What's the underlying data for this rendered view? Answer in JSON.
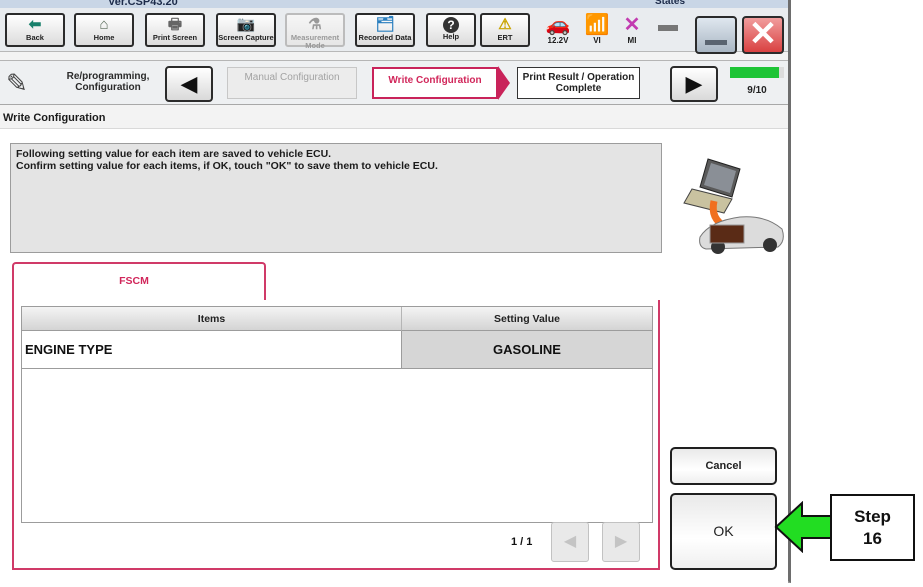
{
  "window": {
    "version": "Ver.CSP43.20",
    "states_label": "States"
  },
  "toolbar": {
    "buttons": [
      {
        "label": "Back",
        "icon": "back-arrow-icon",
        "glyph": "⬅",
        "enabled": true
      },
      {
        "label": "Home",
        "icon": "home-icon",
        "glyph": "⌂",
        "enabled": true
      },
      {
        "label": "Print Screen",
        "icon": "printer-icon",
        "glyph": "🖶",
        "enabled": true
      },
      {
        "label": "Screen Capture",
        "icon": "camera-icon",
        "glyph": "📷",
        "enabled": true
      },
      {
        "label": "Measurement Mode",
        "icon": "measurement-icon",
        "glyph": "⚗",
        "enabled": false
      },
      {
        "label": "Recorded Data",
        "icon": "recorded-data-icon",
        "glyph": "🗂",
        "enabled": true
      },
      {
        "label": "Help",
        "icon": "help-icon",
        "glyph": "?",
        "enabled": true
      },
      {
        "label": "ERT",
        "icon": "warning-icon",
        "glyph": "⚠",
        "enabled": true
      }
    ],
    "status": [
      {
        "label": "12.2V",
        "icon": "car-battery-voltage-icon",
        "glyph": "🚗",
        "color": "#1a8fd6"
      },
      {
        "label": "VI",
        "icon": "signal-icon",
        "glyph": "📶",
        "color": "#1a2fd6"
      },
      {
        "label": "MI",
        "icon": "mi-disconnected-icon",
        "glyph": "✕",
        "color": "#c23bb0"
      },
      {
        "label": "",
        "icon": "battery-icon",
        "glyph": "▬",
        "color": "#777777"
      }
    ],
    "minimize_glyph": "",
    "close_glyph": "✕"
  },
  "stepnav": {
    "section_label": "Re/programming, Configuration",
    "prev_glyph": "◀",
    "next_glyph": "▶",
    "steps": [
      {
        "label": "Manual Configuration",
        "state": "done"
      },
      {
        "label": "Write Configuration",
        "state": "current"
      },
      {
        "label": "Print Result / Operation Complete",
        "state": "upcoming"
      }
    ],
    "progress": {
      "current": 9,
      "total": 10,
      "fraction": 0.9,
      "text": "9/10",
      "color": "#1dc435"
    }
  },
  "page": {
    "title": "Write Configuration",
    "message_lines": [
      "Following setting value for each item are saved to vehicle ECU.",
      "Confirm setting value for each items, if OK, touch \"OK\" to save them to vehicle ECU."
    ]
  },
  "tabs": [
    {
      "label": "FSCM",
      "active": true
    }
  ],
  "table": {
    "columns": [
      "Items",
      "Setting Value"
    ],
    "rows": [
      {
        "item": "ENGINE TYPE",
        "value": "GASOLINE"
      }
    ]
  },
  "pagination": {
    "text": "1 / 1",
    "prev_glyph": "◀",
    "next_glyph": "▶"
  },
  "actions": {
    "cancel_label": "Cancel",
    "ok_label": "OK"
  },
  "annotation": {
    "line1": "Step",
    "line2": "16",
    "arrow_color": "#22dd22"
  },
  "colors": {
    "accent": "#d1265a",
    "progress": "#1dc435",
    "close": "#d94141"
  }
}
